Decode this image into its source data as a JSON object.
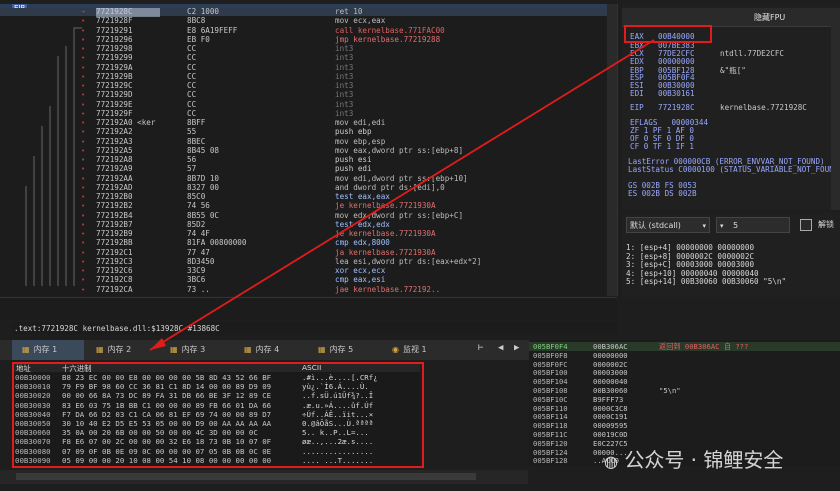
{
  "disasm": {
    "eip_label": "EIP",
    "rows": [
      {
        "addr": "7721928C",
        "bytes": "C2 1000",
        "asm": "ret 10",
        "k": "c-mov",
        "cur": true
      },
      {
        "addr": "7721928F",
        "bytes": "8BC8",
        "asm": "mov ecx,eax",
        "k": "c-mov"
      },
      {
        "addr": "77219291",
        "bytes": "E8 6A19FEFF",
        "asm": "call kernelbase.771FAC00",
        "k": "c-call"
      },
      {
        "addr": "77219296",
        "bytes": "EB F0",
        "asm": "jmp kernelbase.77219288",
        "k": "c-jmp"
      },
      {
        "addr": "77219298",
        "bytes": "CC",
        "asm": "int3",
        "k": "c-int3"
      },
      {
        "addr": "77219299",
        "bytes": "CC",
        "asm": "int3",
        "k": "c-int3"
      },
      {
        "addr": "7721929A",
        "bytes": "CC",
        "asm": "int3",
        "k": "c-int3"
      },
      {
        "addr": "7721929B",
        "bytes": "CC",
        "asm": "int3",
        "k": "c-int3"
      },
      {
        "addr": "7721929C",
        "bytes": "CC",
        "asm": "int3",
        "k": "c-int3"
      },
      {
        "addr": "7721929D",
        "bytes": "CC",
        "asm": "int3",
        "k": "c-int3"
      },
      {
        "addr": "7721929E",
        "bytes": "CC",
        "asm": "int3",
        "k": "c-int3"
      },
      {
        "addr": "7721929F",
        "bytes": "CC",
        "asm": "int3",
        "k": "c-int3"
      },
      {
        "addr": "772192A0 <ker",
        "bytes": "8BFF",
        "asm": "mov edi,edi",
        "k": "c-mov"
      },
      {
        "addr": "772192A2",
        "bytes": "55",
        "asm": "push ebp",
        "k": "c-push"
      },
      {
        "addr": "772192A3",
        "bytes": "8BEC",
        "asm": "mov ebp,esp",
        "k": "c-mov"
      },
      {
        "addr": "772192A5",
        "bytes": "8B45 08",
        "asm": "mov eax,dword ptr ss:[ebp+8]",
        "k": "c-mov"
      },
      {
        "addr": "772192A8",
        "bytes": "56",
        "asm": "push esi",
        "k": "c-push"
      },
      {
        "addr": "772192A9",
        "bytes": "57",
        "asm": "push edi",
        "k": "c-push"
      },
      {
        "addr": "772192AA",
        "bytes": "8B7D 10",
        "asm": "mov edi,dword ptr ss:[ebp+10]",
        "k": "c-mov"
      },
      {
        "addr": "772192AD",
        "bytes": "8327 00",
        "asm": "and dword ptr ds:[edi],0",
        "k": "c-mov"
      },
      {
        "addr": "772192B0",
        "bytes": "85C0",
        "asm": "test eax,eax",
        "k": "c-test"
      },
      {
        "addr": "772192B2",
        "bytes": "74 56",
        "asm": "je kernelbase.7721930A",
        "k": "c-jmp"
      },
      {
        "addr": "772192B4",
        "bytes": "8B55 0C",
        "asm": "mov edx,dword ptr ss:[ebp+C]",
        "k": "c-mov"
      },
      {
        "addr": "772192B7",
        "bytes": "85D2",
        "asm": "test edx,edx",
        "k": "c-test"
      },
      {
        "addr": "772192B9",
        "bytes": "74 4F",
        "asm": "je kernelbase.7721930A",
        "k": "c-jmp"
      },
      {
        "addr": "772192BB",
        "bytes": "81FA 00800000",
        "asm": "cmp edx,8000",
        "k": "c-test"
      },
      {
        "addr": "772192C1",
        "bytes": "77 47",
        "asm": "ja kernelbase.7721930A",
        "k": "c-jmp"
      },
      {
        "addr": "772192C3",
        "bytes": "8D3450",
        "asm": "lea esi,dword ptr ds:[eax+edx*2]",
        "k": "c-mov"
      },
      {
        "addr": "772192C6",
        "bytes": "33C9",
        "asm": "xor ecx,ecx",
        "k": "c-test"
      },
      {
        "addr": "772192C8",
        "bytes": "3BC6",
        "asm": "cmp eax,esi",
        "k": "c-test"
      },
      {
        "addr": "772192CA",
        "bytes": "73 ..",
        "asm": "jae kernelbase.772192..",
        "k": "c-jmp"
      }
    ]
  },
  "info_line": ".text:7721928C kernelbase.dll:$13928C #13868C",
  "regs": {
    "hide_fpu": "隐藏FPU",
    "lines": [
      {
        "n": "EAX",
        "v": "00B40000",
        "c": ""
      },
      {
        "n": "EBX",
        "v": "007BE383",
        "c": ""
      },
      {
        "n": "ECX",
        "v": "77DE2CFC",
        "c": "ntdll.77DE2CFC"
      },
      {
        "n": "EDX",
        "v": "00000000",
        "c": ""
      },
      {
        "n": "EBP",
        "v": "005BF128",
        "c": "&\"瓶[\""
      },
      {
        "n": "ESP",
        "v": "005BF0F4",
        "c": ""
      },
      {
        "n": "ESI",
        "v": "00B30000",
        "c": ""
      },
      {
        "n": "EDI",
        "v": "00B30161",
        "c": ""
      },
      {
        "n": "EIP",
        "v": "7721928C",
        "c": "kernelbase.7721928C"
      }
    ],
    "eflags_label": "EFLAGS",
    "eflags_value": "00000344",
    "flags": [
      "ZF 1  PF 1  AF 0",
      "OF 0  SF 0  DF 0",
      "CF 0  TF 1  IF 1"
    ],
    "last_error": "LastError  000000CB (ERROR_ENVVAR_NOT_FOUND)",
    "last_status": "LastStatus C0000100 (STATUS_VARIABLE_NOT_FOUND)",
    "seg1": "GS 002B  FS 0053",
    "seg2": "ES 002B  DS 002B"
  },
  "args": {
    "conv": "默认 (stdcall)",
    "count": "5",
    "unlock": "解锁",
    "lines": [
      "1: [esp+4] 00000000 00000000",
      "2: [esp+8] 0000002C 0000002C",
      "3: [esp+C] 00003000 00003000",
      "4: [esp+10] 00000040 00000040",
      "5: [esp+14] 00B30060 00B30060 \"5\\n\""
    ]
  },
  "tabs": [
    {
      "label": "内存 1",
      "active": true
    },
    {
      "label": "内存 2"
    },
    {
      "label": "内存 3"
    },
    {
      "label": "内存 4"
    },
    {
      "label": "内存 5"
    },
    {
      "label": "监视 1"
    }
  ],
  "dump": {
    "h_addr": "地址",
    "h_hex": "十六进制",
    "h_ascii": "ASCII",
    "rows": [
      {
        "a": "00B30000",
        "h": "B8 23 EC 00 00 E8 00 00 00 00 5B 8D 43 52 66 BF",
        "s": ".#ì...è....[.CRf¿"
      },
      {
        "a": "00B30010",
        "h": "79 F9 BF 98 60 CC 36 81 C1 8D 14 00 00 89 D9 09",
        "s": "yù¿.`Ì6.Á....Ù."
      },
      {
        "a": "00B30020",
        "h": "00 00 66 8A 73 DC 89 FA 31 DB 66 BE 3F 12 89 CE",
        "s": "..f.sÜ.ú1Ûf¾?..Î"
      },
      {
        "a": "00B30030",
        "h": "83 E6 03 75 1B BB C1 00 00 00 89 FB 66 01 DA 66",
        "s": ".æ.u.»Á....ûf.Úf"
      },
      {
        "a": "00B30040",
        "h": "F7 DA 66 D2 03 C1 CA 06 81 EF 69 74 00 00 89 D7",
        "s": "÷Úf..ÁÊ..ïit...×"
      },
      {
        "a": "00B30050",
        "h": "30 10 40 E2 D5 E5 53 05 00 00 D9 00 AA AA AA AA",
        "s": "0.@âÕåS...Ù.ªªªª"
      },
      {
        "a": "00B30060",
        "h": "35 0A 00 20 6B 00 00 50 00 00 4C 3D 00 00 0C",
        "s": "5.. k..P..L=..."
      },
      {
        "a": "00B30070",
        "h": "F8 E6 07 00 2C 00 00 00 32 E6 18 73 0B 10 07 0F",
        "s": "øæ..,...2æ.s...."
      },
      {
        "a": "00B30080",
        "h": "07 09 0F 0B 0E 09 0C 00 00 00 07 05 0B 0B 0C 0E",
        "s": "................"
      },
      {
        "a": "00B30090",
        "h": "05 09 00 00 20 10 08 00 54 10 08 00 00 00 00 00",
        "s": ".... ...T......."
      }
    ]
  },
  "stack": {
    "rows": [
      {
        "a": "005BF0F4",
        "v": "00B306AC",
        "c": "返回到 00B306AC 自 ???",
        "hl": true
      },
      {
        "a": "005BF0F8",
        "v": "00000000",
        "c": ""
      },
      {
        "a": "005BF0FC",
        "v": "0000002C",
        "c": ""
      },
      {
        "a": "005BF100",
        "v": "00003000",
        "c": ""
      },
      {
        "a": "005BF104",
        "v": "00000040",
        "c": ""
      },
      {
        "a": "005BF108",
        "v": "00B30060",
        "c": "\"5\\n\""
      },
      {
        "a": "005BF10C",
        "v": "B9FFF73",
        "c": ""
      },
      {
        "a": "005BF110",
        "v": "0000C3C8",
        "c": ""
      },
      {
        "a": "005BF114",
        "v": "0000C191",
        "c": ""
      },
      {
        "a": "005BF118",
        "v": "00009595",
        "c": ""
      },
      {
        "a": "005BF11C",
        "v": "00019C0D",
        "c": ""
      },
      {
        "a": "005BF120",
        "v": "E0C227C5",
        "c": ""
      },
      {
        "a": "005BF124",
        "v": "00000...",
        "c": ""
      },
      {
        "a": "005BF128",
        "v": "..ACC0",
        "c": ""
      }
    ]
  },
  "watermark": "公众号 · 锦鲤安全"
}
